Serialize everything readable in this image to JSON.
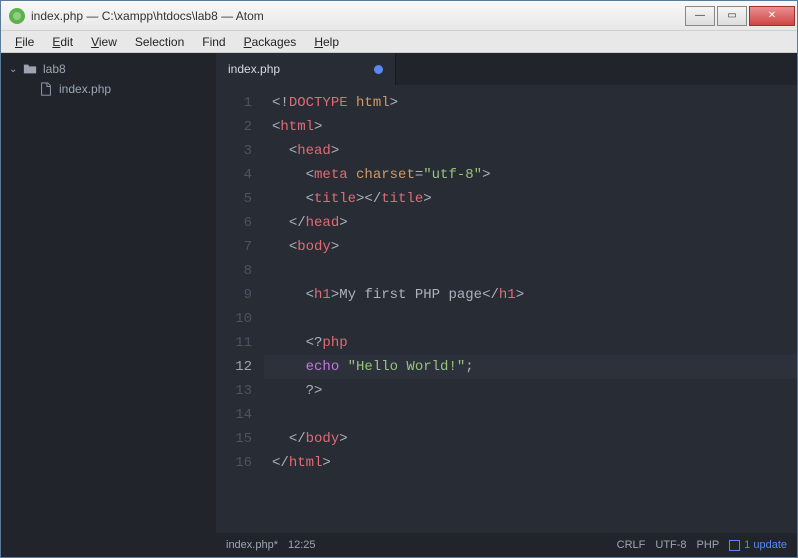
{
  "window": {
    "title": "index.php — C:\\xampp\\htdocs\\lab8 — Atom"
  },
  "menu": {
    "items": [
      "File",
      "Edit",
      "View",
      "Selection",
      "Find",
      "Packages",
      "Help"
    ]
  },
  "sidebar": {
    "project": "lab8",
    "files": [
      "index.php"
    ]
  },
  "tabs": {
    "active": {
      "title": "index.php",
      "modified": true
    }
  },
  "editor": {
    "active_line": 12,
    "lines": [
      {
        "n": 1,
        "tokens": [
          {
            "c": "tok-bracket",
            "t": "<!"
          },
          {
            "c": "tok-tag",
            "t": "DOCTYPE"
          },
          {
            "c": "tok-text",
            "t": " "
          },
          {
            "c": "tok-attr",
            "t": "html"
          },
          {
            "c": "tok-bracket",
            "t": ">"
          }
        ],
        "indent": 0
      },
      {
        "n": 2,
        "tokens": [
          {
            "c": "tok-bracket",
            "t": "<"
          },
          {
            "c": "tok-tag",
            "t": "html"
          },
          {
            "c": "tok-bracket",
            "t": ">"
          }
        ],
        "indent": 0
      },
      {
        "n": 3,
        "tokens": [
          {
            "c": "tok-bracket",
            "t": "<"
          },
          {
            "c": "tok-tag",
            "t": "head"
          },
          {
            "c": "tok-bracket",
            "t": ">"
          }
        ],
        "indent": 1
      },
      {
        "n": 4,
        "tokens": [
          {
            "c": "tok-bracket",
            "t": "<"
          },
          {
            "c": "tok-tag",
            "t": "meta"
          },
          {
            "c": "tok-text",
            "t": " "
          },
          {
            "c": "tok-attr",
            "t": "charset"
          },
          {
            "c": "tok-bracket",
            "t": "="
          },
          {
            "c": "tok-string",
            "t": "\"utf-8\""
          },
          {
            "c": "tok-bracket",
            "t": ">"
          }
        ],
        "indent": 2
      },
      {
        "n": 5,
        "tokens": [
          {
            "c": "tok-bracket",
            "t": "<"
          },
          {
            "c": "tok-tag",
            "t": "title"
          },
          {
            "c": "tok-bracket",
            "t": "></"
          },
          {
            "c": "tok-tag",
            "t": "title"
          },
          {
            "c": "tok-bracket",
            "t": ">"
          }
        ],
        "indent": 2
      },
      {
        "n": 6,
        "tokens": [
          {
            "c": "tok-bracket",
            "t": "</"
          },
          {
            "c": "tok-tag",
            "t": "head"
          },
          {
            "c": "tok-bracket",
            "t": ">"
          }
        ],
        "indent": 1
      },
      {
        "n": 7,
        "tokens": [
          {
            "c": "tok-bracket",
            "t": "<"
          },
          {
            "c": "tok-tag",
            "t": "body"
          },
          {
            "c": "tok-bracket",
            "t": ">"
          }
        ],
        "indent": 1
      },
      {
        "n": 8,
        "tokens": [],
        "indent": 0
      },
      {
        "n": 9,
        "tokens": [
          {
            "c": "tok-bracket",
            "t": "<"
          },
          {
            "c": "tok-tag",
            "t": "h1"
          },
          {
            "c": "tok-bracket",
            "t": ">"
          },
          {
            "c": "tok-text",
            "t": "My first PHP page"
          },
          {
            "c": "tok-bracket",
            "t": "</"
          },
          {
            "c": "tok-tag",
            "t": "h1"
          },
          {
            "c": "tok-bracket",
            "t": ">"
          }
        ],
        "indent": 2
      },
      {
        "n": 10,
        "tokens": [],
        "indent": 0
      },
      {
        "n": 11,
        "tokens": [
          {
            "c": "tok-bracket",
            "t": "<?"
          },
          {
            "c": "tok-php",
            "t": "php"
          }
        ],
        "indent": 2
      },
      {
        "n": 12,
        "tokens": [
          {
            "c": "tok-kw",
            "t": "echo"
          },
          {
            "c": "tok-text",
            "t": " "
          },
          {
            "c": "tok-string",
            "t": "\"Hello World!\""
          },
          {
            "c": "tok-text",
            "t": ";"
          }
        ],
        "indent": 2
      },
      {
        "n": 13,
        "tokens": [
          {
            "c": "tok-bracket",
            "t": "?>"
          }
        ],
        "indent": 2
      },
      {
        "n": 14,
        "tokens": [],
        "indent": 0
      },
      {
        "n": 15,
        "tokens": [
          {
            "c": "tok-bracket",
            "t": "</"
          },
          {
            "c": "tok-tag",
            "t": "body"
          },
          {
            "c": "tok-bracket",
            "t": ">"
          }
        ],
        "indent": 1
      },
      {
        "n": 16,
        "tokens": [
          {
            "c": "tok-bracket",
            "t": "</"
          },
          {
            "c": "tok-tag",
            "t": "html"
          },
          {
            "c": "tok-bracket",
            "t": ">"
          }
        ],
        "indent": 0
      }
    ]
  },
  "status": {
    "file": "index.php*",
    "cursor": "12:25",
    "eol": "CRLF",
    "encoding": "UTF-8",
    "language": "PHP",
    "update": "1 update"
  }
}
